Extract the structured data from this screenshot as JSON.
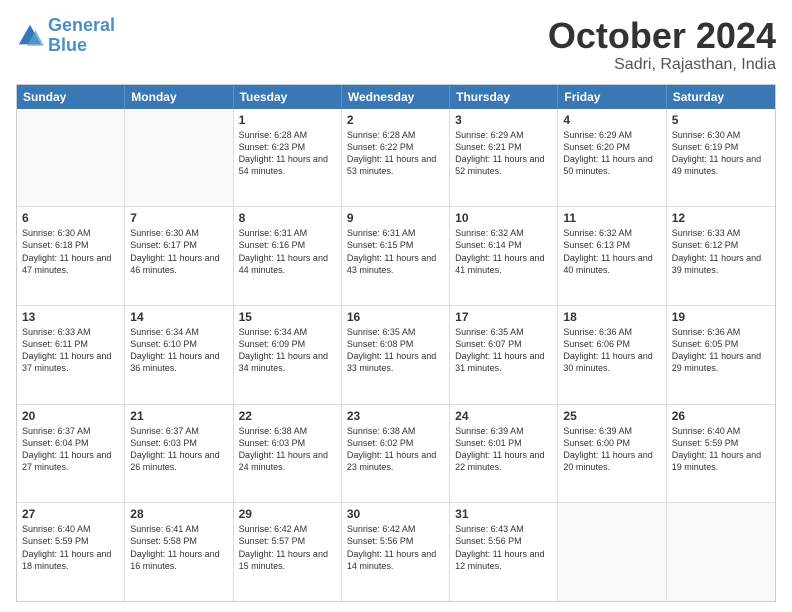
{
  "logo": {
    "line1": "General",
    "line2": "Blue"
  },
  "title": "October 2024",
  "location": "Sadri, Rajasthan, India",
  "days_of_week": [
    "Sunday",
    "Monday",
    "Tuesday",
    "Wednesday",
    "Thursday",
    "Friday",
    "Saturday"
  ],
  "weeks": [
    [
      {
        "day": "",
        "empty": true
      },
      {
        "day": "",
        "empty": true
      },
      {
        "day": "1",
        "sunrise": "Sunrise: 6:28 AM",
        "sunset": "Sunset: 6:23 PM",
        "daylight": "Daylight: 11 hours and 54 minutes."
      },
      {
        "day": "2",
        "sunrise": "Sunrise: 6:28 AM",
        "sunset": "Sunset: 6:22 PM",
        "daylight": "Daylight: 11 hours and 53 minutes."
      },
      {
        "day": "3",
        "sunrise": "Sunrise: 6:29 AM",
        "sunset": "Sunset: 6:21 PM",
        "daylight": "Daylight: 11 hours and 52 minutes."
      },
      {
        "day": "4",
        "sunrise": "Sunrise: 6:29 AM",
        "sunset": "Sunset: 6:20 PM",
        "daylight": "Daylight: 11 hours and 50 minutes."
      },
      {
        "day": "5",
        "sunrise": "Sunrise: 6:30 AM",
        "sunset": "Sunset: 6:19 PM",
        "daylight": "Daylight: 11 hours and 49 minutes."
      }
    ],
    [
      {
        "day": "6",
        "sunrise": "Sunrise: 6:30 AM",
        "sunset": "Sunset: 6:18 PM",
        "daylight": "Daylight: 11 hours and 47 minutes."
      },
      {
        "day": "7",
        "sunrise": "Sunrise: 6:30 AM",
        "sunset": "Sunset: 6:17 PM",
        "daylight": "Daylight: 11 hours and 46 minutes."
      },
      {
        "day": "8",
        "sunrise": "Sunrise: 6:31 AM",
        "sunset": "Sunset: 6:16 PM",
        "daylight": "Daylight: 11 hours and 44 minutes."
      },
      {
        "day": "9",
        "sunrise": "Sunrise: 6:31 AM",
        "sunset": "Sunset: 6:15 PM",
        "daylight": "Daylight: 11 hours and 43 minutes."
      },
      {
        "day": "10",
        "sunrise": "Sunrise: 6:32 AM",
        "sunset": "Sunset: 6:14 PM",
        "daylight": "Daylight: 11 hours and 41 minutes."
      },
      {
        "day": "11",
        "sunrise": "Sunrise: 6:32 AM",
        "sunset": "Sunset: 6:13 PM",
        "daylight": "Daylight: 11 hours and 40 minutes."
      },
      {
        "day": "12",
        "sunrise": "Sunrise: 6:33 AM",
        "sunset": "Sunset: 6:12 PM",
        "daylight": "Daylight: 11 hours and 39 minutes."
      }
    ],
    [
      {
        "day": "13",
        "sunrise": "Sunrise: 6:33 AM",
        "sunset": "Sunset: 6:11 PM",
        "daylight": "Daylight: 11 hours and 37 minutes."
      },
      {
        "day": "14",
        "sunrise": "Sunrise: 6:34 AM",
        "sunset": "Sunset: 6:10 PM",
        "daylight": "Daylight: 11 hours and 36 minutes."
      },
      {
        "day": "15",
        "sunrise": "Sunrise: 6:34 AM",
        "sunset": "Sunset: 6:09 PM",
        "daylight": "Daylight: 11 hours and 34 minutes."
      },
      {
        "day": "16",
        "sunrise": "Sunrise: 6:35 AM",
        "sunset": "Sunset: 6:08 PM",
        "daylight": "Daylight: 11 hours and 33 minutes."
      },
      {
        "day": "17",
        "sunrise": "Sunrise: 6:35 AM",
        "sunset": "Sunset: 6:07 PM",
        "daylight": "Daylight: 11 hours and 31 minutes."
      },
      {
        "day": "18",
        "sunrise": "Sunrise: 6:36 AM",
        "sunset": "Sunset: 6:06 PM",
        "daylight": "Daylight: 11 hours and 30 minutes."
      },
      {
        "day": "19",
        "sunrise": "Sunrise: 6:36 AM",
        "sunset": "Sunset: 6:05 PM",
        "daylight": "Daylight: 11 hours and 29 minutes."
      }
    ],
    [
      {
        "day": "20",
        "sunrise": "Sunrise: 6:37 AM",
        "sunset": "Sunset: 6:04 PM",
        "daylight": "Daylight: 11 hours and 27 minutes."
      },
      {
        "day": "21",
        "sunrise": "Sunrise: 6:37 AM",
        "sunset": "Sunset: 6:03 PM",
        "daylight": "Daylight: 11 hours and 26 minutes."
      },
      {
        "day": "22",
        "sunrise": "Sunrise: 6:38 AM",
        "sunset": "Sunset: 6:03 PM",
        "daylight": "Daylight: 11 hours and 24 minutes."
      },
      {
        "day": "23",
        "sunrise": "Sunrise: 6:38 AM",
        "sunset": "Sunset: 6:02 PM",
        "daylight": "Daylight: 11 hours and 23 minutes."
      },
      {
        "day": "24",
        "sunrise": "Sunrise: 6:39 AM",
        "sunset": "Sunset: 6:01 PM",
        "daylight": "Daylight: 11 hours and 22 minutes."
      },
      {
        "day": "25",
        "sunrise": "Sunrise: 6:39 AM",
        "sunset": "Sunset: 6:00 PM",
        "daylight": "Daylight: 11 hours and 20 minutes."
      },
      {
        "day": "26",
        "sunrise": "Sunrise: 6:40 AM",
        "sunset": "Sunset: 5:59 PM",
        "daylight": "Daylight: 11 hours and 19 minutes."
      }
    ],
    [
      {
        "day": "27",
        "sunrise": "Sunrise: 6:40 AM",
        "sunset": "Sunset: 5:59 PM",
        "daylight": "Daylight: 11 hours and 18 minutes."
      },
      {
        "day": "28",
        "sunrise": "Sunrise: 6:41 AM",
        "sunset": "Sunset: 5:58 PM",
        "daylight": "Daylight: 11 hours and 16 minutes."
      },
      {
        "day": "29",
        "sunrise": "Sunrise: 6:42 AM",
        "sunset": "Sunset: 5:57 PM",
        "daylight": "Daylight: 11 hours and 15 minutes."
      },
      {
        "day": "30",
        "sunrise": "Sunrise: 6:42 AM",
        "sunset": "Sunset: 5:56 PM",
        "daylight": "Daylight: 11 hours and 14 minutes."
      },
      {
        "day": "31",
        "sunrise": "Sunrise: 6:43 AM",
        "sunset": "Sunset: 5:56 PM",
        "daylight": "Daylight: 11 hours and 12 minutes."
      },
      {
        "day": "",
        "empty": true
      },
      {
        "day": "",
        "empty": true
      }
    ]
  ]
}
